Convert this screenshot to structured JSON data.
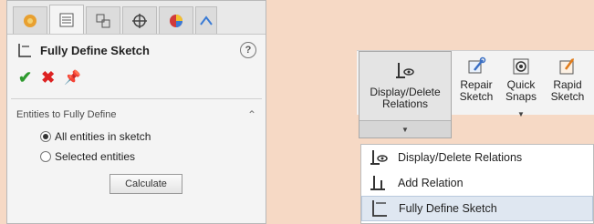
{
  "pm": {
    "tabs": [
      {
        "name": "featuremanager-tab",
        "icon": "featuremanager-icon"
      },
      {
        "name": "propertymanager-tab",
        "icon": "propertymanager-icon"
      },
      {
        "name": "configurationmanager-tab",
        "icon": "configuration-icon"
      },
      {
        "name": "dimxpert-tab",
        "icon": "dimxpert-icon"
      },
      {
        "name": "display-manager-tab",
        "icon": "display-manager-icon"
      }
    ],
    "title": "Fully Define Sketch",
    "help_symbol": "?",
    "ok_symbol": "✔",
    "cancel_symbol": "✖",
    "pin_symbol": "📌",
    "group_title": "Entities to Fully Define",
    "collapse_symbol": "⌃",
    "options": [
      "All entities in sketch",
      "Selected entities"
    ],
    "selected_option": "All entities in sketch",
    "calculate_label": "Calculate"
  },
  "ribbon": {
    "display_delete_label": "Display/Delete Relations",
    "repair_label": "Repair Sketch",
    "snaps_label": "Quick Snaps",
    "rapid_label": "Rapid Sketch",
    "dropdown_arrow": "▼"
  },
  "menu": {
    "items": [
      {
        "label": "Display/Delete Relations",
        "icon": "display-delete-relations-icon"
      },
      {
        "label": "Add Relation",
        "icon": "add-relation-icon"
      },
      {
        "label": "Fully Define Sketch",
        "icon": "fully-define-sketch-icon",
        "highlighted": true
      }
    ]
  },
  "colors": {
    "background": "#f6d9c5",
    "ok_green": "#2e9a2e",
    "cancel_red": "#d22222",
    "highlight": "#dfe7f1"
  }
}
